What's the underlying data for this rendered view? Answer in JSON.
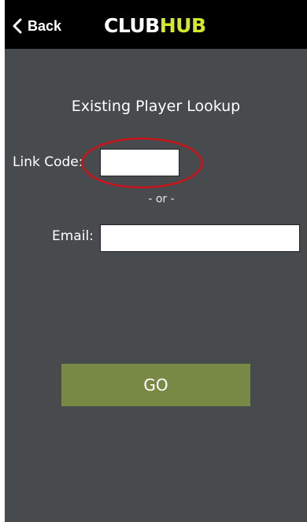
{
  "nav": {
    "back_label": "Back",
    "logo_part1": "CLUB",
    "logo_part2": "HUB"
  },
  "form": {
    "title": "Existing Player Lookup",
    "link_code_label": "Link Code:",
    "link_code_value": "",
    "separator": "- or -",
    "email_label": "Email:",
    "email_value": "",
    "go_label": "GO"
  },
  "colors": {
    "background": "#474b4d",
    "topbar": "#000000",
    "logo_accent": "#d4ea28",
    "go_button": "#788945",
    "annotation_circle": "#c8151b"
  },
  "icons": {
    "back": "chevron-left-icon"
  }
}
